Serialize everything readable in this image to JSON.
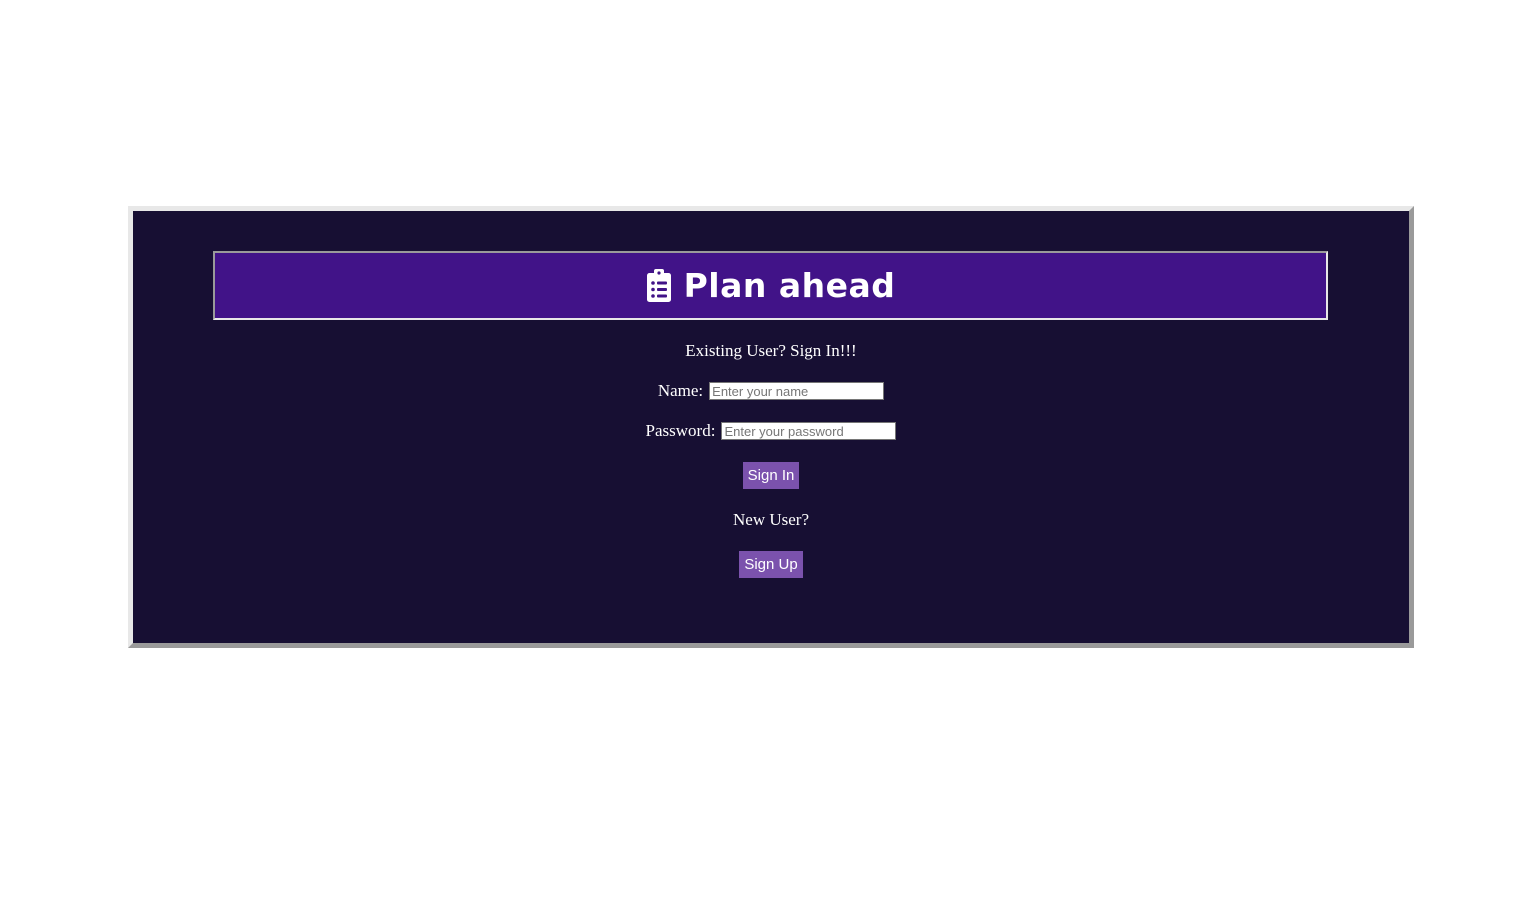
{
  "app": {
    "title": "Plan ahead",
    "icon": "clipboard-list-icon"
  },
  "signin": {
    "heading": "Existing User? Sign In!!!",
    "name_label": "Name:",
    "name_placeholder": "Enter your name",
    "name_value": "",
    "password_label": "Password:",
    "password_placeholder": "Enter your password",
    "password_value": "",
    "submit_label": "Sign In"
  },
  "signup": {
    "prompt": "New User?",
    "button_label": "Sign Up"
  },
  "colors": {
    "page_background": "#ffffff",
    "panel_background": "#170f33",
    "banner_background": "#411388",
    "button_background": "#7b52ad",
    "text": "#ffffff"
  }
}
